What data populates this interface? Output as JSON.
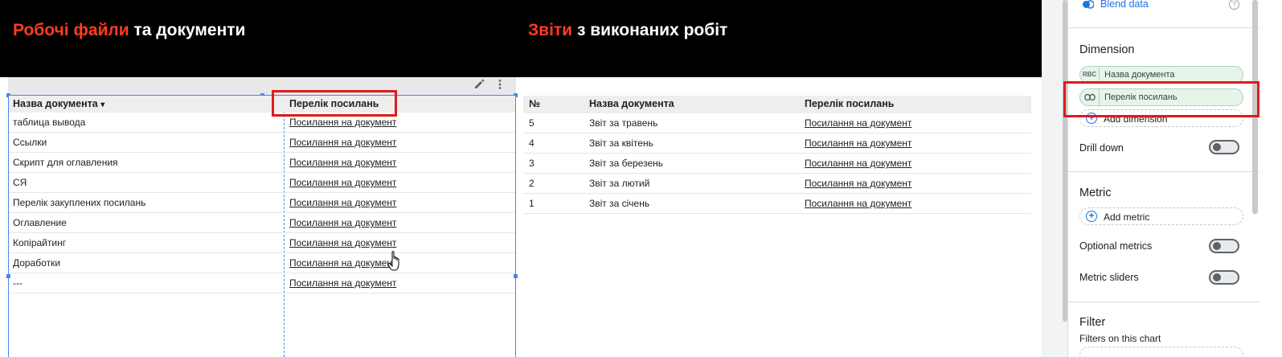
{
  "report": {
    "left_title_accent": "Робочі файли",
    "left_title_rest": " та документи",
    "right_title_accent": "Звіти",
    "right_title_rest": " з виконаних робіт",
    "accent_color": "#ff3d1f"
  },
  "table_left": {
    "col_name": "Назва документа",
    "sort_indicator": "▾",
    "col_link": "Перелік посилань",
    "rows": [
      {
        "name": "таблица вывода",
        "link": "Посилання на документ"
      },
      {
        "name": "Ссылки",
        "link": "Посилання на документ"
      },
      {
        "name": "Скрипт для оглавления",
        "link": "Посилання на документ"
      },
      {
        "name": "СЯ",
        "link": "Посилання на документ"
      },
      {
        "name": "Перелік закуплених посилань",
        "link": "Посилання на документ"
      },
      {
        "name": "Оглавление",
        "link": "Посилання на документ"
      },
      {
        "name": "Копірайтинг",
        "link": "Посилання на документ"
      },
      {
        "name": "Доработки",
        "link": "Посилання на документ"
      },
      {
        "name": "---",
        "link": "Посилання на документ"
      }
    ]
  },
  "table_right": {
    "col_num": "№",
    "col_name": "Назва документа",
    "col_link": "Перелік посилань",
    "rows": [
      {
        "num": "5",
        "name": "Звіт за травень",
        "link": "Посилання на документ"
      },
      {
        "num": "4",
        "name": "Звіт за квітень",
        "link": "Посилання на документ"
      },
      {
        "num": "3",
        "name": "Звіт за березень",
        "link": "Посилання на документ"
      },
      {
        "num": "2",
        "name": "Звіт за лютий",
        "link": "Посилання на документ"
      },
      {
        "num": "1",
        "name": "Звіт за січень",
        "link": "Посилання на документ"
      }
    ]
  },
  "panel": {
    "blend_label": "Blend data",
    "help_glyph": "?",
    "dimension_heading": "Dimension",
    "dimensions": [
      {
        "type_glyph": "RBC",
        "label": "Назва документа"
      },
      {
        "type_glyph": "⊖",
        "label": "Перелік посилань"
      }
    ],
    "add_dimension": "Add dimension",
    "drill_down": "Drill down",
    "metric_heading": "Metric",
    "add_metric": "Add metric",
    "optional_metrics": "Optional metrics",
    "metric_sliders": "Metric sliders",
    "filter_heading": "Filter",
    "filters_on_chart": "Filters on this chart",
    "toggles": {
      "drill_down": false,
      "optional_metrics": false,
      "metric_sliders": false
    }
  }
}
